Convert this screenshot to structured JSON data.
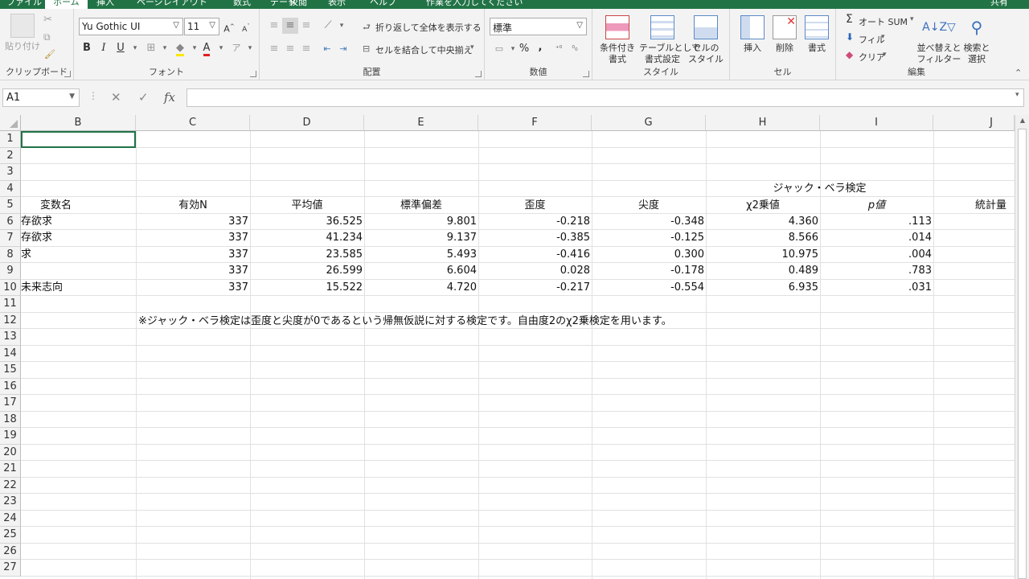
{
  "tabs": {
    "t1": "ファイル",
    "t2": "ホーム",
    "t3": "挿入",
    "t4": "ページレイアウト",
    "t5": "数式",
    "t6": "データ",
    "t7": "校閲",
    "t8": "表示",
    "t9": "ヘルプ",
    "tellme": "作業を入力してください",
    "share": "共有"
  },
  "ribbon": {
    "clipboard": {
      "label": "クリップボード",
      "paste": "貼り付け"
    },
    "font": {
      "label": "フォント",
      "name": "Yu Gothic UI",
      "size": "11",
      "bold": "B",
      "italic": "I",
      "underline": "U"
    },
    "alignment": {
      "label": "配置",
      "wrap": "折り返して全体を表示する",
      "merge": "セルを結合して中央揃え"
    },
    "number": {
      "label": "数値",
      "format": "標準",
      "percent": "%",
      "comma": ","
    },
    "styles": {
      "label": "スタイル",
      "cond1": "条件付き",
      "cond2": "書式",
      "table1": "テーブルとして",
      "table2": "書式設定",
      "cell1": "セルの",
      "cell2": "スタイル"
    },
    "cells": {
      "label": "セル",
      "insert": "挿入",
      "delete": "削除",
      "format": "書式"
    },
    "editing": {
      "label": "編集",
      "autosum": "オート SUM",
      "fill": "フィル",
      "clear": "クリア",
      "sort1": "並べ替えと",
      "sort2": "フィルター",
      "find1": "検索と",
      "find2": "選択"
    }
  },
  "formula_bar": {
    "name_box": "A1",
    "fx": "fx",
    "cancel": "✕",
    "enter": "✓",
    "value": ""
  },
  "columns": [
    "B",
    "C",
    "D",
    "E",
    "F",
    "G",
    "H",
    "I",
    "J"
  ],
  "rows": [
    "1",
    "2",
    "3",
    "4",
    "5",
    "6",
    "7",
    "8",
    "9",
    "10",
    "11",
    "12",
    "13",
    "14",
    "15",
    "16",
    "17",
    "18",
    "19",
    "20",
    "21",
    "22",
    "23",
    "24",
    "25",
    "26",
    "27"
  ],
  "sheet": {
    "h4": "ジャック・ベラ検定",
    "headers": {
      "var": "変数名",
      "n": "有効N",
      "mean": "平均値",
      "sd": "標準偏差",
      "skew": "歪度",
      "kurt": "尖度",
      "chi": "χ2乗値",
      "p": "p値",
      "stat": "統計量"
    },
    "data": [
      {
        "name": "存欲求",
        "n": "337",
        "mean": "36.525",
        "sd": "9.801",
        "skew": "-0.218",
        "kurt": "-0.348",
        "chi": "4.360",
        "p": ".113"
      },
      {
        "name": "存欲求",
        "n": "337",
        "mean": "41.234",
        "sd": "9.137",
        "skew": "-0.385",
        "kurt": "-0.125",
        "chi": "8.566",
        "p": ".014"
      },
      {
        "name": "求",
        "n": "337",
        "mean": "23.585",
        "sd": "5.493",
        "skew": "-0.416",
        "kurt": "0.300",
        "chi": "10.975",
        "p": ".004"
      },
      {
        "name": "",
        "n": "337",
        "mean": "26.599",
        "sd": "6.604",
        "skew": "0.028",
        "kurt": "-0.178",
        "chi": "0.489",
        "p": ".783"
      },
      {
        "name": "未来志向",
        "n": "337",
        "mean": "15.522",
        "sd": "4.720",
        "skew": "-0.217",
        "kurt": "-0.554",
        "chi": "6.935",
        "p": ".031"
      }
    ],
    "note": "※ジャック・ベラ検定は歪度と尖度が0であるという帰無仮説に対する検定です。自由度2のχ2乗検定を用います。"
  }
}
